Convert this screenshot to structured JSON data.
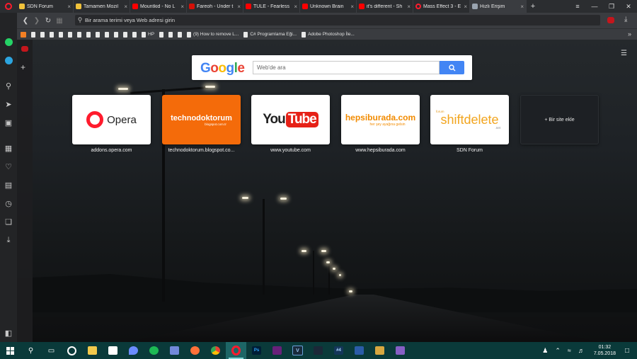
{
  "tabs": [
    {
      "title": "SDN Forum",
      "favicon": "sdn-icon",
      "color": "#f0c23b",
      "active": false
    },
    {
      "title": "Tamamen Mozil",
      "favicon": "sdn-icon",
      "color": "#f0c23b",
      "active": false
    },
    {
      "title": "Mountkid - No L",
      "favicon": "youtube-icon",
      "color": "#ff0000",
      "active": false
    },
    {
      "title": "Fareoh - Under t",
      "favicon": "lastfm-icon",
      "color": "#d51007",
      "active": false
    },
    {
      "title": "TULE - Fearless",
      "favicon": "youtube-icon",
      "color": "#ff0000",
      "active": false
    },
    {
      "title": "Unknown Brain",
      "favicon": "youtube-icon",
      "color": "#ff0000",
      "active": false
    },
    {
      "title": "it's different - Sh",
      "favicon": "youtube-icon",
      "color": "#ff0000",
      "active": false
    },
    {
      "title": "Mass Effect 3 - E",
      "favicon": "opera-icon",
      "color": "#ff1b2d",
      "active": false
    },
    {
      "title": "Hızlı Erişim",
      "favicon": "speed-dial-icon",
      "color": "#9aa4b0",
      "active": true
    }
  ],
  "address": {
    "placeholder": "Bir arama terimi veya Web adresi girin"
  },
  "bookmarks": [
    {
      "label": "",
      "icon": "blogger-icon",
      "style": "orange"
    },
    {
      "label": "",
      "icon": "page-icon",
      "style": ""
    },
    {
      "label": "",
      "icon": "page-icon",
      "style": ""
    },
    {
      "label": "",
      "icon": "page-icon",
      "style": ""
    },
    {
      "label": "",
      "icon": "page-icon",
      "style": ""
    },
    {
      "label": "",
      "icon": "page-icon",
      "style": ""
    },
    {
      "label": "",
      "icon": "page-icon",
      "style": ""
    },
    {
      "label": "",
      "icon": "page-icon",
      "style": ""
    },
    {
      "label": "",
      "icon": "page-icon",
      "style": ""
    },
    {
      "label": "",
      "icon": "page-icon",
      "style": ""
    },
    {
      "label": "",
      "icon": "page-icon",
      "style": ""
    },
    {
      "label": "",
      "icon": "page-icon",
      "style": ""
    },
    {
      "label": "",
      "icon": "page-icon",
      "style": ""
    },
    {
      "label": "HP",
      "icon": "page-icon",
      "style": ""
    },
    {
      "label": "",
      "icon": "page-icon",
      "style": ""
    },
    {
      "label": "",
      "icon": "page-icon",
      "style": ""
    },
    {
      "label": "",
      "icon": "page-icon",
      "style": ""
    },
    {
      "label": "(9) How to remove L...",
      "icon": "page-icon",
      "style": ""
    },
    {
      "label": "C# Programlama Eği...",
      "icon": "page-icon",
      "style": ""
    },
    {
      "label": "Adobe Photoshop İle...",
      "icon": "page-icon",
      "style": ""
    }
  ],
  "search": {
    "logo": "Google",
    "placeholder": "Web'de ara"
  },
  "speed_dials": [
    {
      "caption": "addons.opera.com",
      "tile": "opera"
    },
    {
      "caption": "technodoktorum.blogspot.co...",
      "tile": "techno"
    },
    {
      "caption": "www.youtube.com",
      "tile": "youtube"
    },
    {
      "caption": "www.hepsiburada.com",
      "tile": "hepsi"
    },
    {
      "caption": "SDN Forum",
      "tile": "sdn"
    }
  ],
  "tiles": {
    "opera": {
      "logo_text": "Opera"
    },
    "techno": {
      "title": "technodoktorum",
      "sub": "blogspot.com.tr"
    },
    "youtube": {
      "you": "You",
      "tube": "Tube"
    },
    "hepsi": {
      "title": "hepsiburada.com",
      "tagline": "her şey ayağına gelsin"
    },
    "sdn": {
      "small": "forum",
      "title": "shiftdelete",
      "suffix": ".net"
    }
  },
  "add_site": {
    "label": "+ Bir site ekle"
  },
  "clock": {
    "time": "01:32",
    "date": "7.05.2018"
  },
  "colors": {
    "opera_red": "#ff1b2d",
    "google_blue": "#4285f4",
    "taskbar": "#0a3a3a"
  }
}
